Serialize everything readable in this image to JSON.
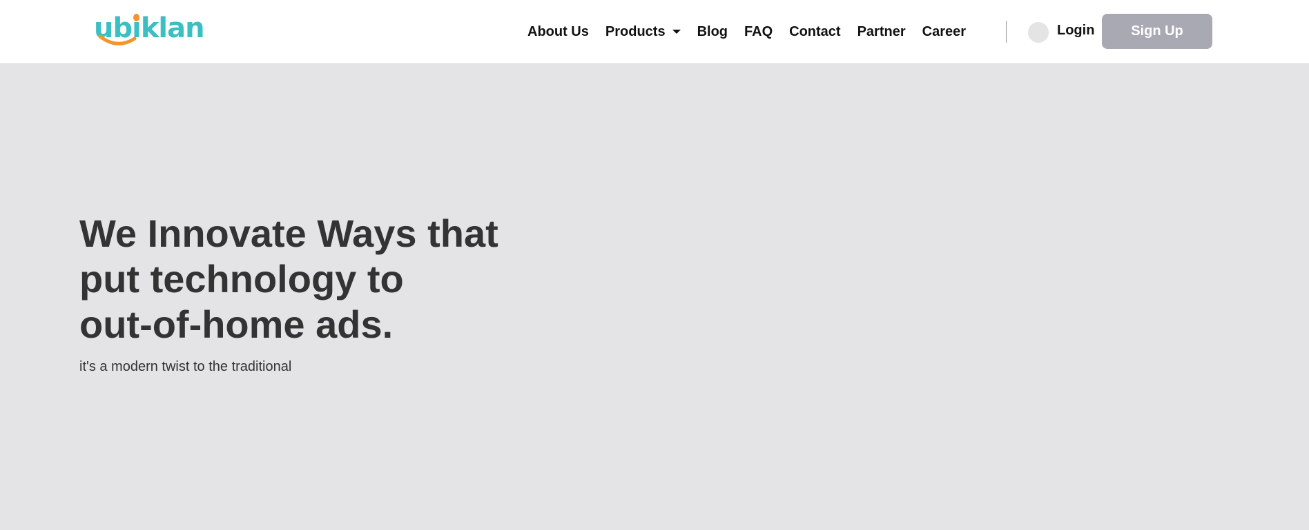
{
  "brand": {
    "name": "ubiklan",
    "primary_color": "#3bbfc3",
    "accent_color": "#f1962d"
  },
  "nav": {
    "items": [
      {
        "label": "About Us"
      },
      {
        "label": "Products",
        "has_dropdown": true
      },
      {
        "label": "Blog"
      },
      {
        "label": "FAQ"
      },
      {
        "label": "Contact"
      },
      {
        "label": "Partner"
      },
      {
        "label": "Career"
      }
    ],
    "login_label": "Login",
    "signup_label": "Sign Up",
    "signup_color": "#a9a9b4"
  },
  "hero": {
    "title_lines": [
      "We Innovate Ways that",
      "put technology to",
      "out-of-home ads."
    ],
    "subtitle": "it's a modern twist to the traditional"
  },
  "colors": {
    "background": "#e4e4e6",
    "header": "#ffffff",
    "text": "#333333"
  }
}
